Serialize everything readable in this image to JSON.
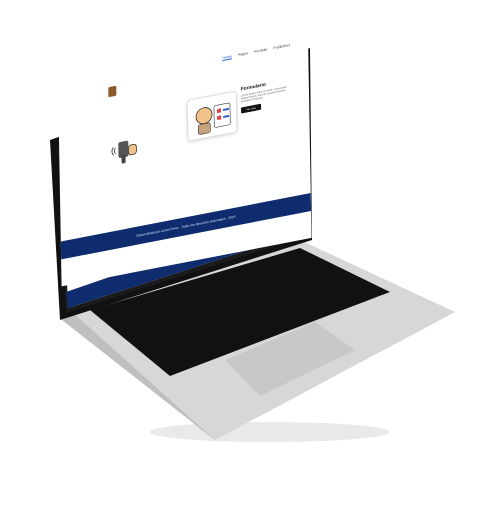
{
  "nav": {
    "items": [
      "Home",
      "Pages",
      "Portfolio",
      "Publishers"
    ],
    "active_index": 0
  },
  "hero": {
    "form_title": "Formulario",
    "form_desc": "Lorem ipsum dolor sit amet, consectetur adipiscing elit. Sed do eiusmod tempor incididunt ut labore.",
    "form_button": "Ver más"
  },
  "footer": {
    "text": "Desarrollado por Lucas Perez · Todos los derechos reservados · 2023"
  },
  "colors": {
    "footer_bg": "#0f2c6e",
    "nav_active": "#2a62c9"
  }
}
